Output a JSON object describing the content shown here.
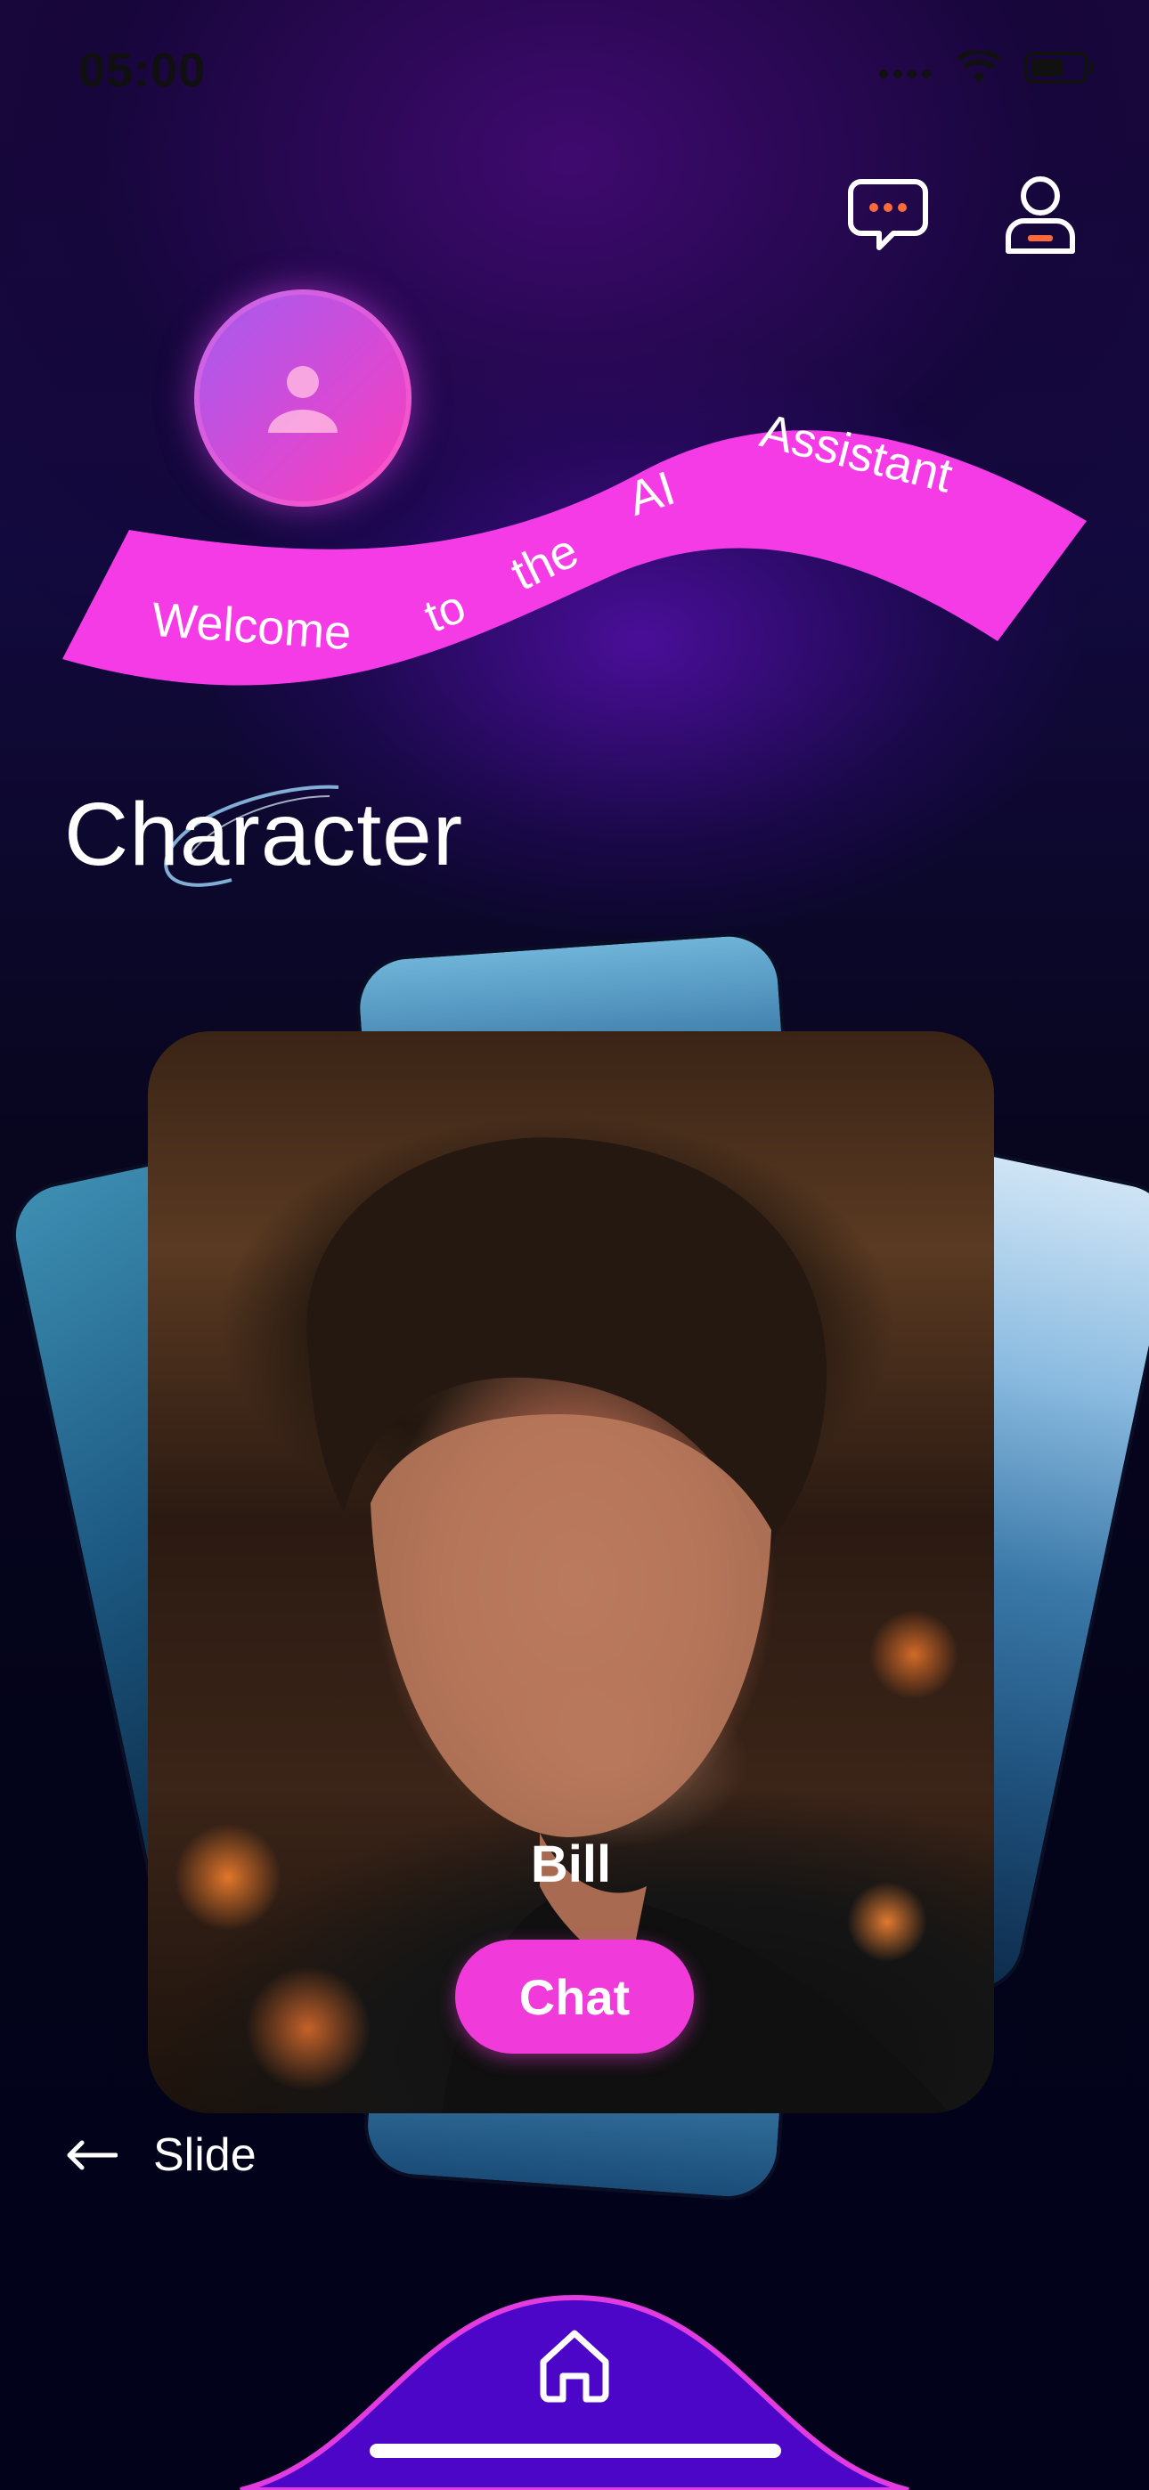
{
  "status_bar": {
    "time": "05:00"
  },
  "header": {
    "chat_icon": "chat-bubble-icon",
    "profile_icon": "user-profile-icon"
  },
  "banner": {
    "words": [
      "Welcome",
      "to",
      "the",
      "AI",
      "Assistant"
    ]
  },
  "section": {
    "title": "Character"
  },
  "character": {
    "name": "Bill",
    "chat_label": "Chat"
  },
  "slide_hint": {
    "label": "Slide",
    "icon": "arrow-left-icon"
  },
  "bottom_nav": {
    "home_icon": "home-icon"
  },
  "colors": {
    "accent": "#f03ad9",
    "banner": "#f53be6",
    "nav": "#4b06c8"
  }
}
